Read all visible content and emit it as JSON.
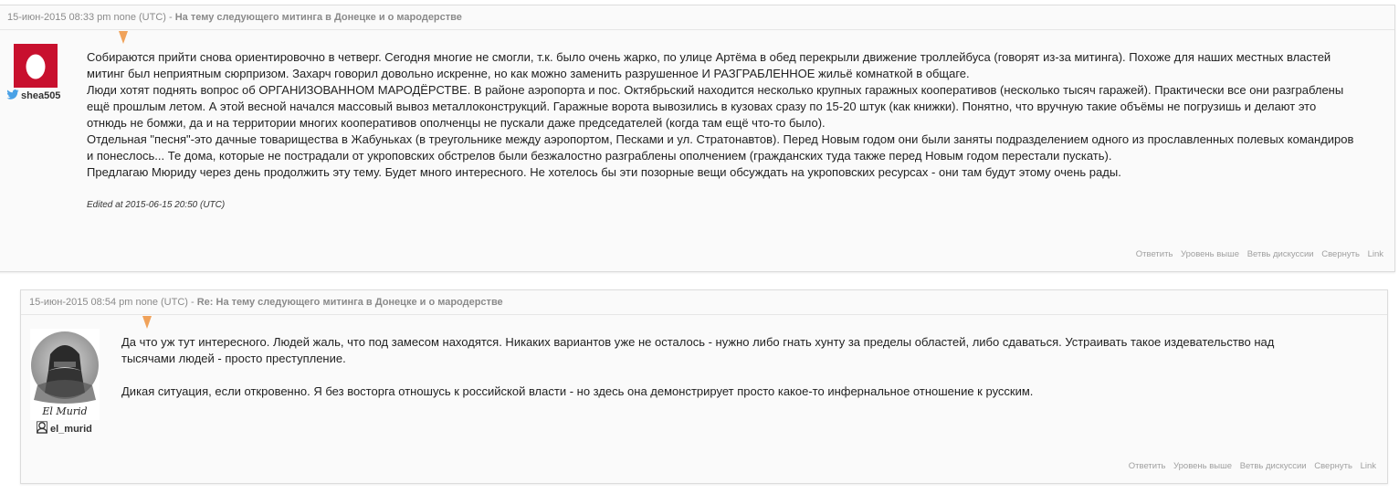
{
  "comments": [
    {
      "date": "15-июн-2015 08:33 pm none (UTC)",
      "separator": " - ",
      "subject": "На тему следующего митинга в Донецке и о мародерстве",
      "username": "shea505",
      "body": [
        "Собираются прийти снова ориентировочно в четверг. Сегодня многие не смогли, т.к. было очень жарко, по улице Артёма в обед перекрыли движение троллейбуса (говорят из-за митинга). Похоже для наших местных властей митинг был неприятным сюрпризом. Захарч говорил довольно искренне, но как можно заменить разрушенное И РАЗГРАБЛЕННОЕ жильё комнаткой в общаге.",
        "Люди хотят поднять вопрос об ОРГАНИЗОВАННОМ МАРОДЁРСТВЕ. В районе аэропорта и пос. Октябрьский находится несколько крупных гаражных кооперативов (несколько тысяч гаражей). Практически все они разграблены ещё прошлым летом. А этой весной начался массовый вывоз металлоконструкций. Гаражные ворота вывозились в кузовах сразу по 15-20 штук (как книжки). Понятно, что вручную такие объёмы не погрузишь и делают это отнюдь не бомжи, да и на территории многих кооперативов ополченцы не пускали даже председателей (когда там ещё что-то было).",
        "Отдельная \"песня\"-это дачные товарищества в Жабуньках (в треугольнике между аэропортом, Песками и ул. Стратонавтов). Перед Новым годом они были заняты подразделением одного из прославленных полевых командиров и понеслось... Те дома, которые не пострадали от укроповских обстрелов были безжалостно разграблены ополчением (гражданских туда также перед Новым годом перестали пускать).",
        "Предлагаю Мюриду через день продолжить эту тему. Будет много интересного. Не хотелось бы эти позорные вещи обсуждать на укроповских ресурсах - они там будут этому очень рады."
      ],
      "edited": "Edited at 2015-06-15 20:50 (UTC)"
    },
    {
      "date": "15-июн-2015 08:54 pm none (UTC)",
      "separator": " - ",
      "subject": "Re: На тему следующего митинга в Донецке и о мародерстве",
      "username": "el_murid",
      "userpic_caption": "El Murid",
      "body": [
        "Да что уж тут интересного. Людей жаль, что под замесом находятся. Никаких вариантов уже не осталось - нужно либо гнать хунту за пределы областей, либо сдаваться. Устраивать такое издевательство над тысячами людей - просто преступление.",
        "Дикая ситуация, если откровенно. Я без восторга отношусь к российской власти - но здесь она демонстрирует просто какое-то инфернальное отношение к русским."
      ]
    }
  ],
  "actions": [
    "Ответить",
    "Уровень выше",
    "Ветвь дискуссии",
    "Свернуть",
    "Link"
  ],
  "colors": {
    "marker": "#f0a25a",
    "twitter": "#4aa1e6",
    "userpic_red": "#c8102e"
  },
  "icons": {
    "comment1_user": "twitter-bird-icon",
    "comment2_user": "livejournal-user-icon"
  }
}
